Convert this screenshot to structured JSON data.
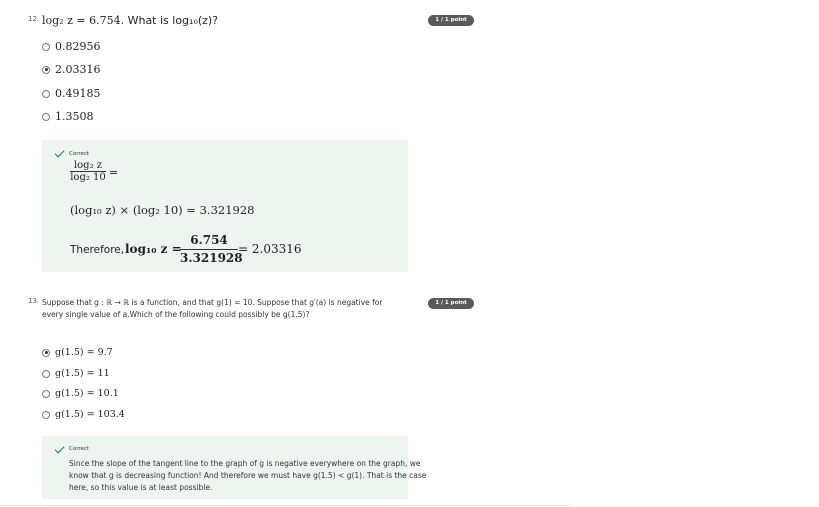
{
  "q12": {
    "number": "12.",
    "prompt_math": "log₂ z = 6.754.",
    "prompt_text": "What is log₁₀(z)?",
    "badge": "1 / 1 point",
    "options": [
      "0.82956",
      "2.03316",
      "0.49185",
      "1.3508"
    ],
    "selected_index": 1,
    "feedback": {
      "status": "Correct",
      "frac_num": "log₂ z",
      "frac_den": "log₂ 10",
      "eq1": "=",
      "line2": "(log₁₀ z) × (log₂ 10) = 3.321928",
      "therefore": "Therefore,",
      "therefore_lhs": "log₁₀ z =",
      "frac2_num": "6.754",
      "frac2_den": "3.321928",
      "result": "= 2.03316"
    }
  },
  "q13": {
    "number": "13.",
    "prompt_line1": "Suppose that g : ℝ → ℝ is a function, and that g(1) = 10. Suppose that g′(a) is negative for",
    "prompt_line2": "every single value of a.Which of the following could possibly be g(1.5)?",
    "badge": "1 / 1 point",
    "options": [
      "g(1.5) = 9.7",
      "g(1.5) = 11",
      "g(1.5) = 10.1",
      "g(1.5) = 103.4"
    ],
    "selected_index": 0,
    "feedback": {
      "status": "Correct",
      "line1": "Since the slope of the tangent line to the graph of g is negative everywhere on the graph, we",
      "line2": "know that g is decreasing function! And therefore we must have g(1.5) < g(1). That is the case",
      "line3": "here, so this value is at least possible."
    }
  }
}
